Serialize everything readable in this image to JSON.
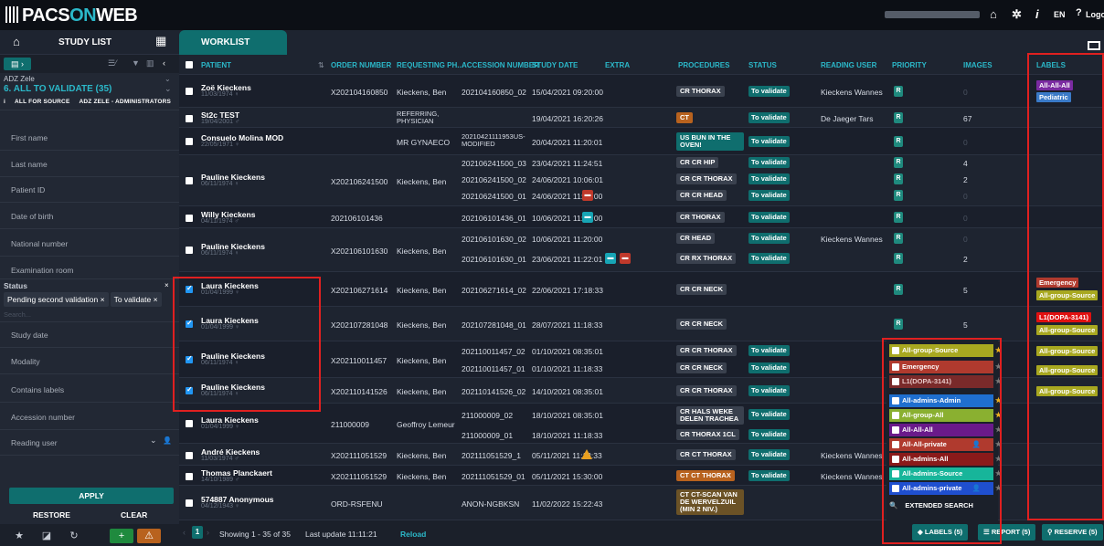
{
  "app": {
    "logo_a": "PACS",
    "logo_b": "ON",
    "logo_c": "WEB"
  },
  "top_right": {
    "lang": "EN",
    "help": "?",
    "logout": "Logou"
  },
  "tabs": {
    "study_list": "STUDY LIST",
    "worklist": "WORKLIST"
  },
  "sidebar": {
    "org": "ADZ Zele",
    "view": "6. ALL TO VALIDATE (35)",
    "scope_a": "ALL FOR SOURCE",
    "scope_b": "ADZ ZELE - ADMINISTRATORS",
    "filters": [
      "First name",
      "Last name",
      "Patient ID",
      "Date of birth",
      "National number",
      "Examination room"
    ],
    "status_label": "Status",
    "status_chips": [
      "Pending second validation ×",
      "To validate ×"
    ],
    "search_placeholder": "Search...",
    "filters2": [
      "Study date",
      "Modality",
      "Contains labels",
      "Accession number",
      "Reading user"
    ],
    "apply": "APPLY",
    "restore": "RESTORE",
    "clear": "CLEAR"
  },
  "columns": [
    "PATIENT",
    "ORDER NUMBER",
    "REQUESTING PH...",
    "ACCESSION NUMBER",
    "STUDY DATE",
    "EXTRA",
    "PROCEDURES",
    "STATUS",
    "READING USER",
    "PRIORITY",
    "IMAGES",
    "LABELS"
  ],
  "rows": [
    {
      "name": "Zoë Kieckens",
      "dob": "11/03/1974 ♀",
      "order": "X202104160850",
      "req": "Kieckens, Ben",
      "acc": [
        "202104160850_02"
      ],
      "date": [
        "15/04/2021 09:20:00"
      ],
      "proc": [
        "CR THORAX"
      ],
      "status": [
        "To validate"
      ],
      "reader": "Kieckens Wannes",
      "pri": [
        "R"
      ],
      "img": [
        "0"
      ],
      "labels": [
        "All-All-All",
        "Pediatric"
      ]
    },
    {
      "name": "St2c TEST",
      "dob": "19/04/2001 ♂",
      "order": "",
      "req": "REFERRING, PHYSICIAN",
      "acc": [
        ""
      ],
      "date": [
        "19/04/2021 16:20:26"
      ],
      "proc": [
        "CT"
      ],
      "status": [
        "To validate"
      ],
      "reader": "De Jaeger Tars",
      "pri": [
        "R"
      ],
      "img": [
        "67"
      ],
      "labels": []
    },
    {
      "name": "Consuelo Molina MOD",
      "dob": "22/05/1971 ♀",
      "order": "",
      "req": "MR GYNAECO",
      "acc": [
        "20210421111953US-MODIFIED"
      ],
      "date": [
        "20/04/2021 11:20:01"
      ],
      "proc": [
        "US BUN IN THE OVEN!"
      ],
      "status": [
        "To validate"
      ],
      "reader": "",
      "pri": [
        "R"
      ],
      "img": [
        "0"
      ],
      "labels": []
    },
    {
      "name": "Pauline Kieckens",
      "dob": "06/11/1974 ♀",
      "order": "X202106241500",
      "req": "Kieckens, Ben",
      "acc": [
        "202106241500_03",
        "202106241500_02",
        "202106241500_01"
      ],
      "date": [
        "23/04/2021 11:24:51",
        "24/06/2021 10:06:01",
        "24/06/2021 11:20:00"
      ],
      "proc": [
        "CR CR HIP",
        "CR CR THORAX",
        "CR CR HEAD"
      ],
      "status": [
        "To validate",
        "To validate",
        "To validate"
      ],
      "reader": "",
      "pri": [
        "R",
        "R",
        "R"
      ],
      "img": [
        "4",
        "2",
        "0"
      ],
      "labels": []
    },
    {
      "name": "Willy Kieckens",
      "dob": "04/11/1974 ♂",
      "order": "202106101436",
      "req": "",
      "acc": [
        "202106101436_01"
      ],
      "date": [
        "10/06/2021 11:15:00"
      ],
      "proc": [
        "CR THORAX"
      ],
      "status": [
        "To validate"
      ],
      "reader": "",
      "pri": [
        "R"
      ],
      "img": [
        "0"
      ],
      "labels": []
    },
    {
      "name": "Pauline Kieckens",
      "dob": "06/11/1974 ♀",
      "order": "X202106101630",
      "req": "Kieckens, Ben",
      "acc": [
        "202106101630_02",
        "202106101630_01"
      ],
      "date": [
        "10/06/2021 11:20:00",
        "23/06/2021 11:22:01"
      ],
      "proc": [
        "CR HEAD",
        "CR RX THORAX"
      ],
      "status": [
        "To validate",
        "To validate"
      ],
      "reader": "Kieckens Wannes",
      "pri": [
        "R",
        "R"
      ],
      "img": [
        "0",
        "2"
      ],
      "labels": []
    },
    {
      "name": "Laura Kieckens",
      "dob": "01/04/1999 ♀",
      "order": "X202106271614",
      "req": "Kieckens, Ben",
      "acc": [
        "202106271614_02"
      ],
      "date": [
        "22/06/2021 17:18:33"
      ],
      "proc": [
        "CR CR NECK"
      ],
      "status": [
        "To validate"
      ],
      "reader": "",
      "pri": [
        "R"
      ],
      "img": [
        "5"
      ],
      "labels": [
        "Emergency",
        "All-group-Source"
      ]
    },
    {
      "name": "Laura Kieckens",
      "dob": "01/04/1999 ♀",
      "order": "X202107281048",
      "req": "Kieckens, Ben",
      "acc": [
        "202107281048_01"
      ],
      "date": [
        "28/07/2021 11:18:33"
      ],
      "proc": [
        "CR CR NECK"
      ],
      "status": [
        "To validate"
      ],
      "reader": "",
      "pri": [
        "R"
      ],
      "img": [
        "5"
      ],
      "labels": [
        "L1(DOPA-3141)",
        "All-group-Source"
      ]
    },
    {
      "name": "Pauline Kieckens",
      "dob": "06/11/1974 ♀",
      "order": "X202110011457",
      "req": "Kieckens, Ben",
      "acc": [
        "202110011457_02",
        "202110011457_01"
      ],
      "date": [
        "01/10/2021 08:35:01",
        "01/10/2021 11:18:33"
      ],
      "proc": [
        "CR CR THORAX",
        "CR CR NECK"
      ],
      "status": [
        "To validate",
        "To validate"
      ],
      "reader": "",
      "pri": [],
      "img": [],
      "labels": [
        "All-group-Source",
        "All-group-Source"
      ]
    },
    {
      "name": "Pauline Kieckens",
      "dob": "06/11/1974 ♀",
      "order": "X202110141526",
      "req": "Kieckens, Ben",
      "acc": [
        "202110141526_02"
      ],
      "date": [
        "14/10/2021 08:35:01"
      ],
      "proc": [
        "CR CR THORAX"
      ],
      "status": [
        "To validate"
      ],
      "reader": "",
      "pri": [],
      "img": [],
      "labels": [
        "All-group-Source"
      ]
    },
    {
      "name": "Laura Kieckens",
      "dob": "01/04/1999 ♀",
      "order": "211000009",
      "req": "Geoffroy Lemeur",
      "acc": [
        "211000009_02",
        "211000009_01"
      ],
      "date": [
        "18/10/2021 08:35:01",
        "18/10/2021 11:18:33"
      ],
      "proc": [
        "CR HALS WEKE DELEN TRACHEA",
        "CR THORAX 1CL"
      ],
      "status": [
        "To validate",
        "To validate"
      ],
      "reader": "",
      "pri": [],
      "img": [],
      "labels": []
    },
    {
      "name": "André Kieckens",
      "dob": "11/03/1974 ♂",
      "order": "X202111051529",
      "req": "Kieckens, Ben",
      "acc": [
        "202111051529_1"
      ],
      "date": [
        "05/11/2021 11:18:33"
      ],
      "proc": [
        "CR CT THORAX"
      ],
      "status": [
        "To validate"
      ],
      "reader": "Kieckens Wannes",
      "pri": [],
      "img": [],
      "labels": []
    },
    {
      "name": "Thomas Planckaert",
      "dob": "14/10/1989 ♂",
      "order": "X202111051529",
      "req": "Kieckens, Ben",
      "acc": [
        "202111051529_01"
      ],
      "date": [
        "05/11/2021 15:30:00"
      ],
      "proc": [
        "CT CT THORAX"
      ],
      "status": [
        "To validate"
      ],
      "reader": "Kieckens Wannes",
      "pri": [],
      "img": [],
      "labels": []
    },
    {
      "name": "574887 Anonymous",
      "dob": "04/12/1943 ♀",
      "order": "ORD-RSFENU",
      "req": "",
      "acc": [
        "ANON-NGBKSN"
      ],
      "date": [
        "11/02/2022 15:22:43"
      ],
      "proc": [
        "CT CT-SCAN VAN DE WERVELZUIL (MIN 2 NIV.)"
      ],
      "status": [
        "To validate"
      ],
      "reader": "",
      "pri": [],
      "img": [],
      "labels": []
    }
  ],
  "label_menu": {
    "items": [
      {
        "text": "All-group-Source",
        "color": "#a8a820"
      },
      {
        "text": "Emergency",
        "color": "#b03a2e"
      },
      {
        "text": "L1(DOPA-3141)",
        "color": "#b03a2e"
      },
      {
        "text": "All-admins-Admin",
        "color": "#1f6fcf"
      },
      {
        "text": "All-group-All",
        "color": "#8ab030"
      },
      {
        "text": "All-All-All",
        "color": "#6a1a8a"
      },
      {
        "text": "All-All-private",
        "color": "#b03a2e"
      },
      {
        "text": "All-admins-All",
        "color": "#8a1a1a"
      },
      {
        "text": "All-admins-Source",
        "color": "#17b59a"
      },
      {
        "text": "All-admins-private",
        "color": "#1f4fcf"
      }
    ],
    "search": "EXTENDED SEARCH"
  },
  "footer": {
    "page": "1",
    "showing": "Showing 1 - 35 of 35",
    "update": "Last update 11:11:21",
    "reload": "Reload",
    "labels_btn": "LABELS (5)",
    "report_btn": "REPORT (5)",
    "reserve_btn": "RESERVE (5)"
  },
  "colors": {
    "teal": "#0f6e6e",
    "accent": "#2bb8c9",
    "red_frame": "#e02020"
  }
}
